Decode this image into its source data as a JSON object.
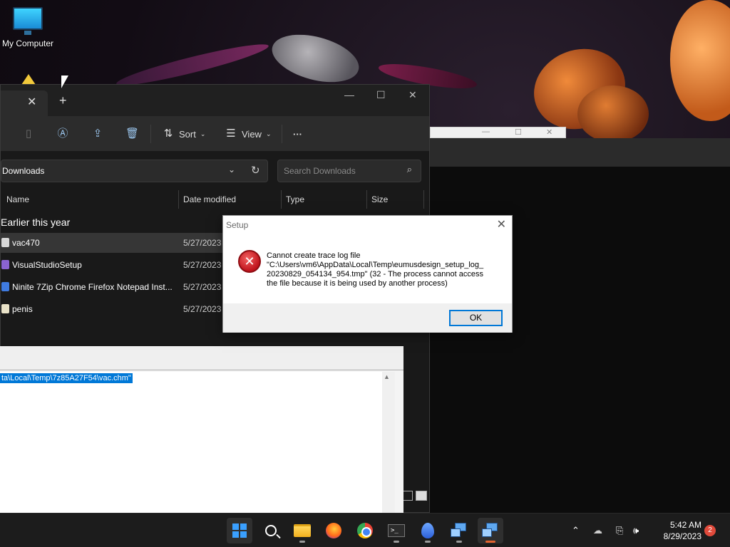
{
  "desktop": {
    "icon_label": "My Computer"
  },
  "explorer": {
    "toolbar": {
      "sort_label": "Sort",
      "view_label": "View",
      "more_label": "···"
    },
    "address": "Downloads",
    "search_placeholder": "Search Downloads",
    "columns": [
      "Name",
      "Date modified",
      "Type",
      "Size"
    ],
    "group_label": "Earlier this year",
    "files": [
      {
        "name": "vac470",
        "date": "5/27/2023",
        "icon_color": "#d8d8d8"
      },
      {
        "name": "VisualStudioSetup",
        "date": "5/27/2023",
        "icon_color": "#8a63d2"
      },
      {
        "name": "Ninite 7Zip Chrome Firefox Notepad Inst...",
        "date": "5/27/2023",
        "icon_color": "#3f7be0"
      },
      {
        "name": "penis",
        "date": "5/27/2023",
        "icon_color": "#e9e2c8"
      }
    ]
  },
  "background_panel": {
    "selected_text": "ta\\Local\\Temp\\7z85A27F54\\vac.chm\""
  },
  "dialog": {
    "title": "Setup",
    "message_lines": [
      "Cannot create trace log file",
      "\"C:\\Users\\vm6\\AppData\\Local\\Temp\\eumusdesign_setup_log_",
      "20230829_054134_954.tmp\" (32 - The process cannot access",
      "the file because it is being used by another process)"
    ],
    "ok_label": "OK"
  },
  "taskbar": {
    "apps": [
      "start-icon",
      "search-icon",
      "file-explorer-icon",
      "firefox-icon",
      "chrome-icon",
      "terminal-icon",
      "drop-app-icon",
      "setup-icon",
      "setup-icon"
    ],
    "time": "5:42 AM",
    "date": "8/29/2023",
    "notification_count": "2"
  },
  "colors": {
    "accent": "#0078d7",
    "error": "#c0141d",
    "explorer_bg": "#191919"
  }
}
